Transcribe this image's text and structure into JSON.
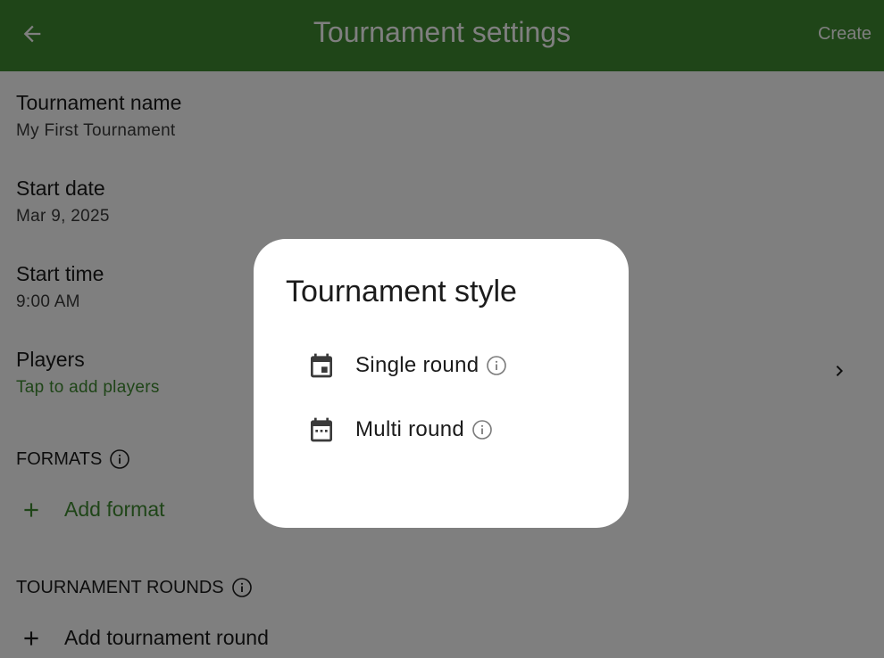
{
  "appbar": {
    "title": "Tournament settings",
    "create_label": "Create",
    "back_icon": "arrow-left-icon"
  },
  "fields": {
    "name": {
      "label": "Tournament name",
      "value": "My First Tournament"
    },
    "start_date": {
      "label": "Start date",
      "value": "Mar 9, 2025"
    },
    "start_time": {
      "label": "Start time",
      "value": "9:00 AM"
    },
    "players": {
      "label": "Players",
      "value": "Tap to add players"
    }
  },
  "sections": {
    "formats": {
      "title": "FORMATS",
      "add_label": "Add format"
    },
    "rounds": {
      "title": "TOURNAMENT ROUNDS",
      "add_label": "Add tournament round"
    }
  },
  "dialog": {
    "title": "Tournament style",
    "options": [
      {
        "label": "Single round",
        "icon": "calendar-single-icon"
      },
      {
        "label": "Multi round",
        "icon": "calendar-multi-icon"
      }
    ]
  },
  "colors": {
    "primary": "#3f8a30",
    "scrim": "rgba(0,0,0,0.5)"
  }
}
